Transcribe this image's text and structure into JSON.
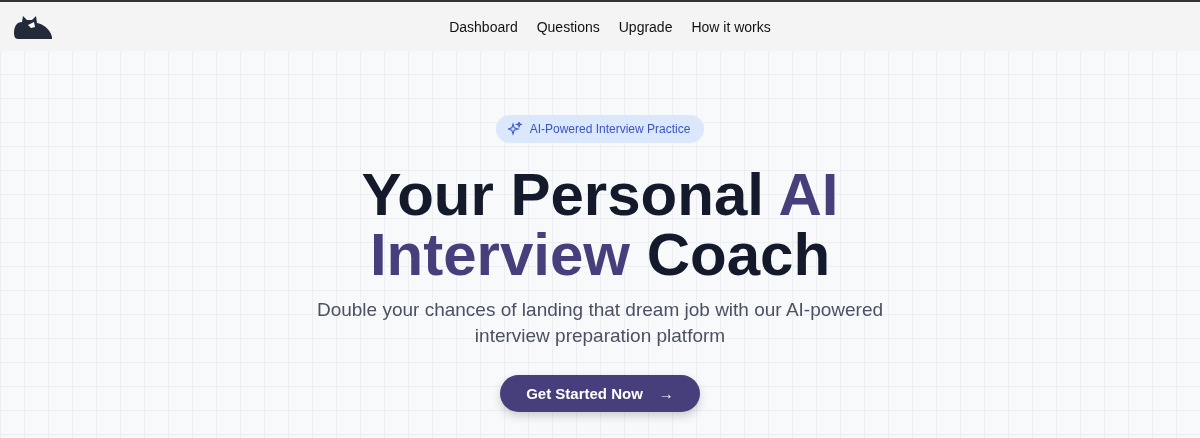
{
  "nav": [
    {
      "label": "Dashboard"
    },
    {
      "label": "Questions"
    },
    {
      "label": "Upgrade"
    },
    {
      "label": "How it works"
    }
  ],
  "badge": {
    "label": "AI-Powered Interview Practice"
  },
  "headline": [
    {
      "text": "Your Personal",
      "accent": false
    },
    {
      "text": "AI",
      "accent": true
    },
    {
      "text": "Interview",
      "accent": true
    },
    {
      "text": "Coach",
      "accent": false
    }
  ],
  "subtitle": "Double your chances of landing that dream job with our AI-powered interview preparation platform",
  "cta": {
    "label": "Get Started Now",
    "arrow": "→"
  }
}
